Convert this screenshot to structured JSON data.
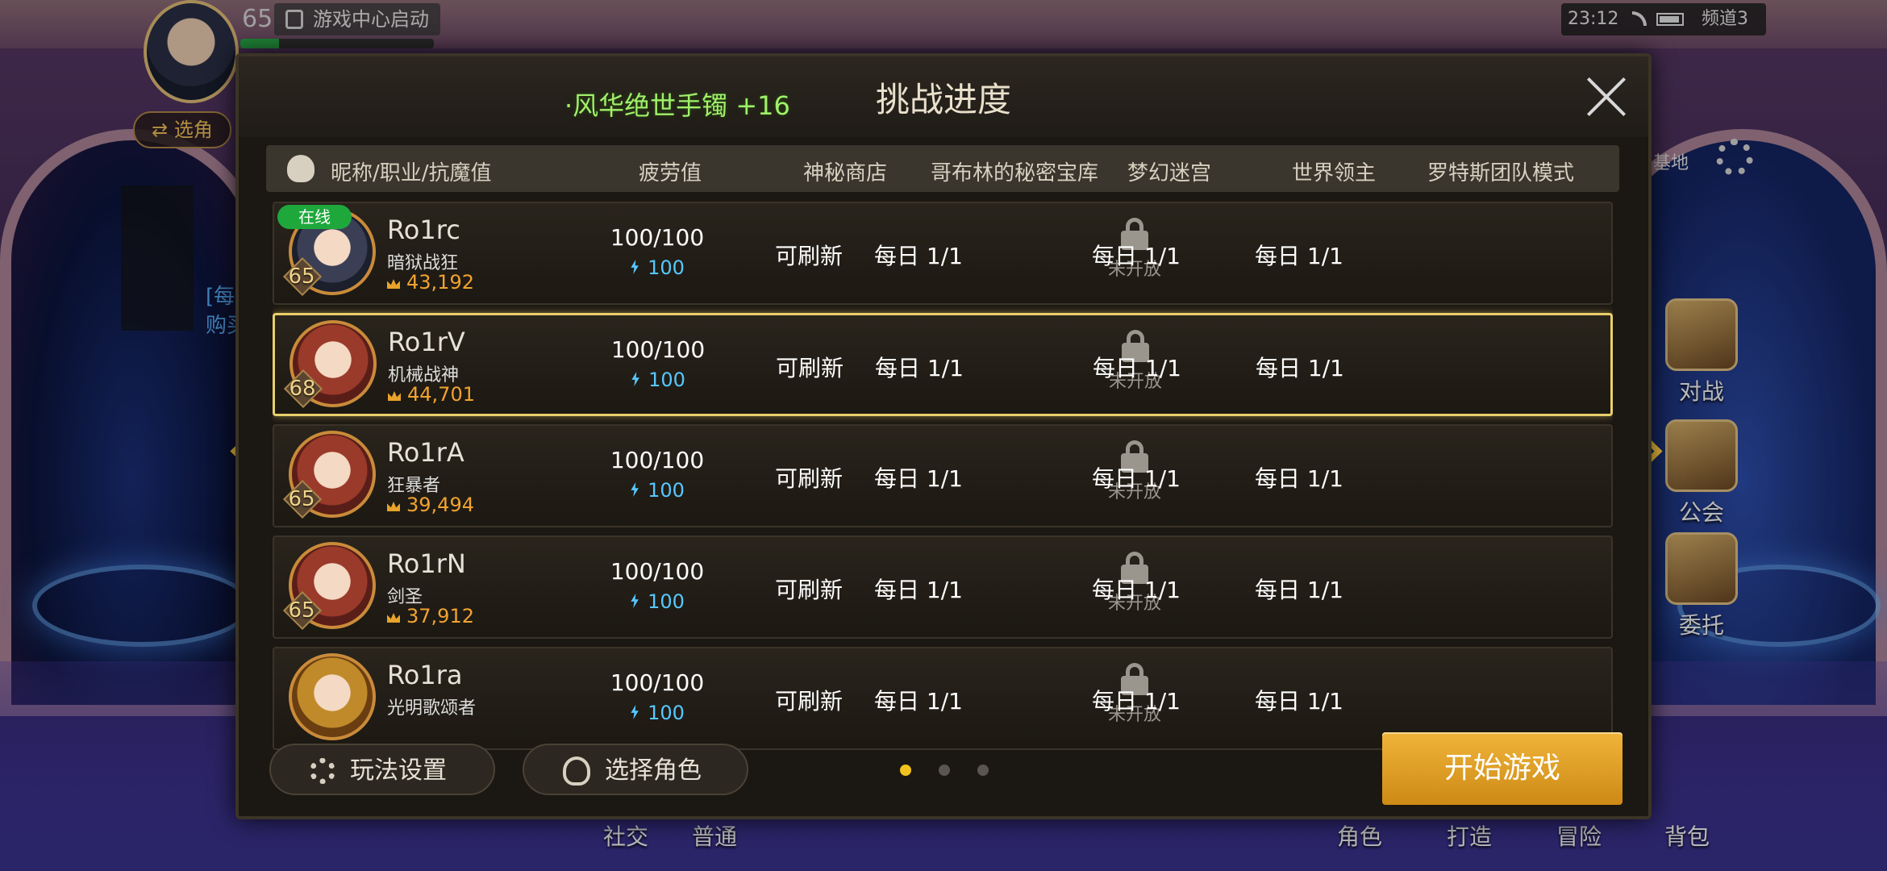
{
  "hud": {
    "level": "65",
    "game_center": "游戏中心启动",
    "exp_fraction": 0.2,
    "switch_role": "⇄ 选角",
    "time": "23:12",
    "channel": "频道3"
  },
  "background_menu": {
    "right": [
      "对战",
      "公会",
      "委托"
    ],
    "bottom": [
      "社交",
      "普通",
      "角色",
      "打造",
      "冒险",
      "背包"
    ],
    "side_text": [
      "[每",
      "购买"
    ],
    "top_right_partial": "基地"
  },
  "dialog": {
    "marquee": "·风华绝世手镯 +16",
    "title": "挑战进度",
    "headers": {
      "name": "昵称/职业/抗魔值",
      "fatigue": "疲劳值",
      "shop": "神秘商店",
      "goblin": "哥布林的秘密宝库",
      "maze": "梦幻迷宫",
      "lord": "世界领主",
      "raid": "罗特斯团队模式"
    },
    "online_tag": "在线",
    "locked_text": "未开放",
    "rows": [
      {
        "name": "Ro1rc",
        "class": "暗狱战狂",
        "level": "65",
        "power": "43,192",
        "fatigue": "100/100",
        "fatigue_sub": "100",
        "shop": "可刷新",
        "goblin": "每日 1/1",
        "lord": "每日 1/1",
        "raid": "每日 1/1"
      },
      {
        "name": "Ro1rV",
        "class": "机械战神",
        "level": "68",
        "power": "44,701",
        "fatigue": "100/100",
        "fatigue_sub": "100",
        "shop": "可刷新",
        "goblin": "每日 1/1",
        "lord": "每日 1/1",
        "raid": "每日 1/1"
      },
      {
        "name": "Ro1rA",
        "class": "狂暴者",
        "level": "65",
        "power": "39,494",
        "fatigue": "100/100",
        "fatigue_sub": "100",
        "shop": "可刷新",
        "goblin": "每日 1/1",
        "lord": "每日 1/1",
        "raid": "每日 1/1"
      },
      {
        "name": "Ro1rN",
        "class": "剑圣",
        "level": "65",
        "power": "37,912",
        "fatigue": "100/100",
        "fatigue_sub": "100",
        "shop": "可刷新",
        "goblin": "每日 1/1",
        "lord": "每日 1/1",
        "raid": "每日 1/1"
      },
      {
        "name": "Ro1ra",
        "class": "光明歌颂者",
        "level": "",
        "power": "",
        "fatigue": "100/100",
        "fatigue_sub": "100",
        "shop": "可刷新",
        "goblin": "每日 1/1",
        "lord": "每日 1/1",
        "raid": "每日 1/1"
      }
    ],
    "footer": {
      "settings": "玩法设置",
      "select_role": "选择角色",
      "start": "开始游戏",
      "page_count": 3,
      "page_current": 1
    }
  },
  "colors": {
    "accent": "#e7b93a",
    "online": "#1ea83c",
    "power": "#f2a330",
    "fatigue": "#56c8ff"
  }
}
